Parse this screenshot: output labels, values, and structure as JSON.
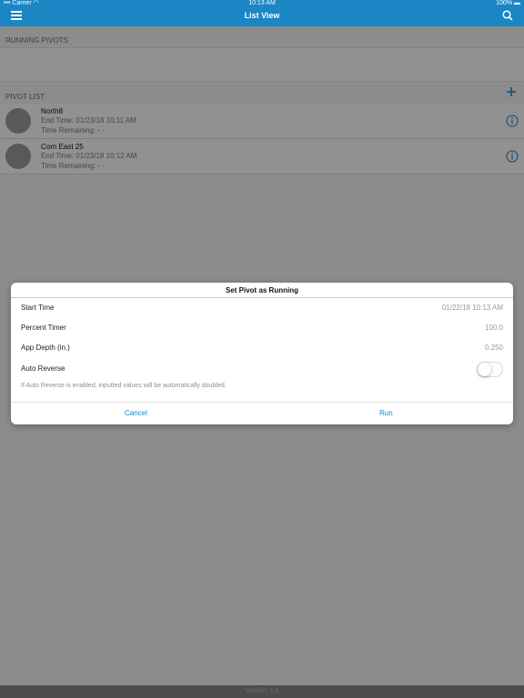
{
  "status_bar": {
    "carrier": "Carrier",
    "time": "10:13 AM",
    "battery": "100%"
  },
  "nav": {
    "title": "List View"
  },
  "sections": {
    "running": "RUNNING PIVOTS",
    "list": "PIVOT LIST"
  },
  "pivots": [
    {
      "name": "North8",
      "end_time": "End Time: 01/23/18 10:11 AM",
      "time_remaining": "Time Remaining: - -"
    },
    {
      "name": "Corn East 25",
      "end_time": "End Time: 01/23/18 10:12 AM",
      "time_remaining": "Time Remaining: - -"
    }
  ],
  "dialog": {
    "title": "Set Pivot as Running",
    "rows": [
      {
        "label": "Start Time",
        "value": "01/22/18 10:13 AM"
      },
      {
        "label": "Percent Timer",
        "value": "100.0"
      },
      {
        "label": "App Depth (in.)",
        "value": "0.250"
      },
      {
        "label": "Auto Reverse"
      }
    ],
    "auto_reverse_on": false,
    "note": "If Auto Reverse is enabled, inputted values will be automatically doubled.",
    "cancel": "Cancel",
    "run": "Run"
  },
  "footer": {
    "version": "Version: 1.0"
  },
  "colors": {
    "accent": "#1a86c4"
  }
}
